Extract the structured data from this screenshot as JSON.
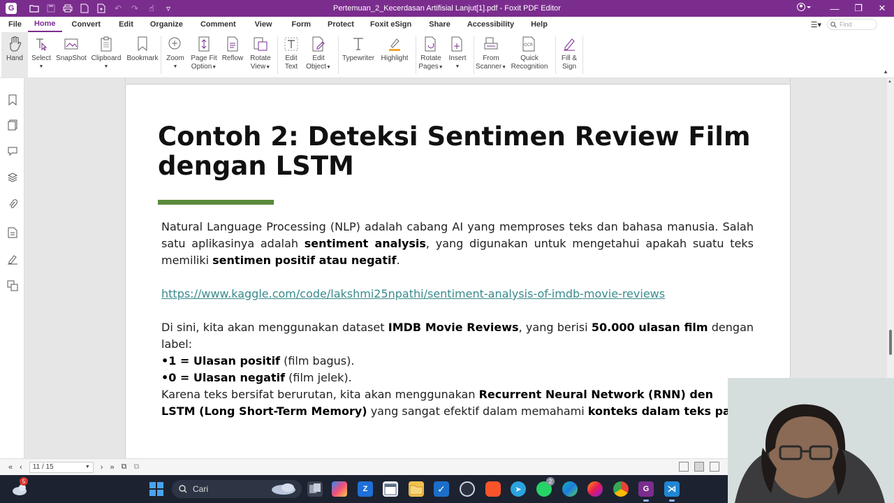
{
  "window": {
    "title": "Pertemuan_2_Kecerdasan Artifisial Lanjut[1].pdf - Foxit PDF Editor"
  },
  "menu": {
    "tabs": [
      "File",
      "Home",
      "Convert",
      "Edit",
      "Organize",
      "Comment",
      "View",
      "Form",
      "Protect",
      "Foxit eSign",
      "Share",
      "Accessibility",
      "Help"
    ],
    "active_tab": "Home",
    "find_placeholder": "Find"
  },
  "ribbon": {
    "hand": "Hand",
    "select": "Select",
    "snapshot": "SnapShot",
    "clipboard": "Clipboard",
    "bookmark": "Bookmark",
    "zoom": "Zoom",
    "page_fit_1": "Page Fit",
    "page_fit_2": "Option",
    "reflow": "Reflow",
    "rotate_view_1": "Rotate",
    "rotate_view_2": "View",
    "edit_text_1": "Edit",
    "edit_text_2": "Text",
    "edit_object_1": "Edit",
    "edit_object_2": "Object",
    "typewriter": "Typewriter",
    "highlight": "Highlight",
    "rotate_pages_1": "Rotate",
    "rotate_pages_2": "Pages",
    "insert": "Insert",
    "from_scanner_1": "From",
    "from_scanner_2": "Scanner",
    "quick_recognition_1": "Quick",
    "quick_recognition_2": "Recognition",
    "fill_sign_1": "Fill &",
    "fill_sign_2": "Sign"
  },
  "document": {
    "title_line1": "Contoh 2: Deteksi Sentimen Review Film",
    "title_line2": "dengan LSTM",
    "p1_a": "Natural Language Processing (NLP) adalah cabang AI yang memproses teks dan bahasa manusia. Salah satu aplikasinya adalah ",
    "p1_b": "sentiment analysis",
    "p1_c": ", yang digunakan untuk mengetahui apakah suatu teks memiliki ",
    "p1_d": "sentimen positif atau negatif",
    "p1_e": ".",
    "link": "https://www.kaggle.com/code/lakshmi25npathi/sentiment-analysis-of-imdb-movie-reviews",
    "p2_a": "Di sini, kita akan menggunakan dataset ",
    "p2_b": "IMDB Movie Reviews",
    "p2_c": ", yang berisi ",
    "p2_d": "50.000 ulasan film",
    "p2_e": " dengan label:",
    "b1_a": "•1 = Ulasan positif",
    "b1_b": " (film bagus).",
    "b2_a": "•0 = Ulasan negatif",
    "b2_b": " (film jelek).",
    "p3_a": "Karena teks bersifat berurutan, kita akan menggunakan ",
    "p3_b": "Recurrent Neural Network (RNN) den",
    "p3_c": "LSTM (Long Short-Term Memory)",
    "p3_d": " yang sangat efektif dalam memahami ",
    "p3_e": "konteks dalam teks panja"
  },
  "status": {
    "page_indicator": "11 / 15"
  },
  "taskbar": {
    "search_label": "Cari",
    "notification_count": "5",
    "whatsapp_badge": "2"
  },
  "colors": {
    "brand": "#7b2d8e",
    "accent_bar": "#5b8a3c",
    "link": "#3a8a8c"
  }
}
